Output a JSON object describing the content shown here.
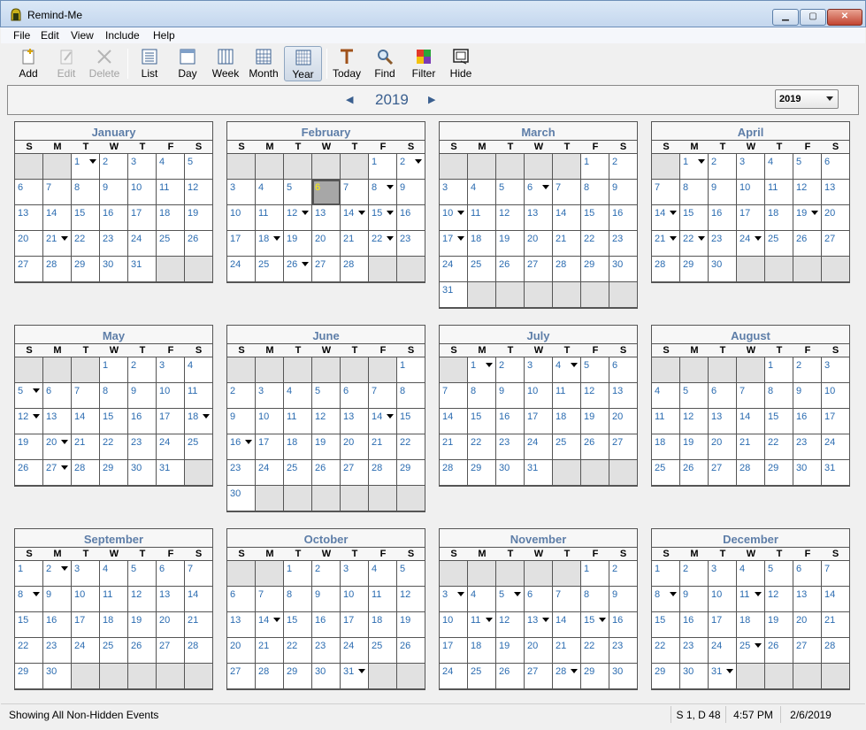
{
  "window": {
    "title": "Remind-Me"
  },
  "menu": [
    "File",
    "Edit",
    "View",
    "Include",
    "Help"
  ],
  "toolbar": {
    "add": "Add",
    "edit": "Edit",
    "delete": "Delete",
    "list": "List",
    "day": "Day",
    "week": "Week",
    "month": "Month",
    "year": "Year",
    "today": "Today",
    "find": "Find",
    "filter": "Filter",
    "hide": "Hide"
  },
  "nav": {
    "year": "2019",
    "select_value": "2019"
  },
  "days_of_week": [
    "S",
    "M",
    "T",
    "W",
    "T",
    "F",
    "S"
  ],
  "months": [
    {
      "name": "January",
      "start": 2,
      "days": 31,
      "events": [
        1,
        21
      ]
    },
    {
      "name": "February",
      "start": 5,
      "days": 28,
      "events": [
        2,
        8,
        12,
        14,
        15,
        18,
        22,
        26
      ],
      "today": 6
    },
    {
      "name": "March",
      "start": 5,
      "days": 31,
      "events": [
        6,
        10,
        17
      ]
    },
    {
      "name": "April",
      "start": 1,
      "days": 30,
      "events": [
        1,
        14,
        19,
        21,
        22,
        24
      ]
    },
    {
      "name": "May",
      "start": 3,
      "days": 31,
      "events": [
        5,
        12,
        18,
        20,
        27
      ]
    },
    {
      "name": "June",
      "start": 6,
      "days": 30,
      "events": [
        14,
        16
      ]
    },
    {
      "name": "July",
      "start": 1,
      "days": 31,
      "events": [
        1,
        4
      ]
    },
    {
      "name": "August",
      "start": 4,
      "days": 31,
      "events": []
    },
    {
      "name": "September",
      "start": 0,
      "days": 30,
      "events": [
        2,
        8
      ]
    },
    {
      "name": "October",
      "start": 2,
      "days": 31,
      "events": [
        14,
        31
      ]
    },
    {
      "name": "November",
      "start": 5,
      "days": 30,
      "events": [
        3,
        5,
        11,
        13,
        15,
        28
      ]
    },
    {
      "name": "December",
      "start": 0,
      "days": 31,
      "events": [
        8,
        11,
        25,
        31
      ]
    }
  ],
  "status": {
    "message": "Showing All Non-Hidden Events",
    "counts": "S 1, D 48",
    "time": "4:57 PM",
    "date": "2/6/2019"
  },
  "colors": {
    "accent": "#5e7ea8",
    "day_text": "#2a6bb0",
    "today_text": "#fff200",
    "today_bg": "#a7a7a7",
    "empty_cell": "#e1e1e1"
  }
}
